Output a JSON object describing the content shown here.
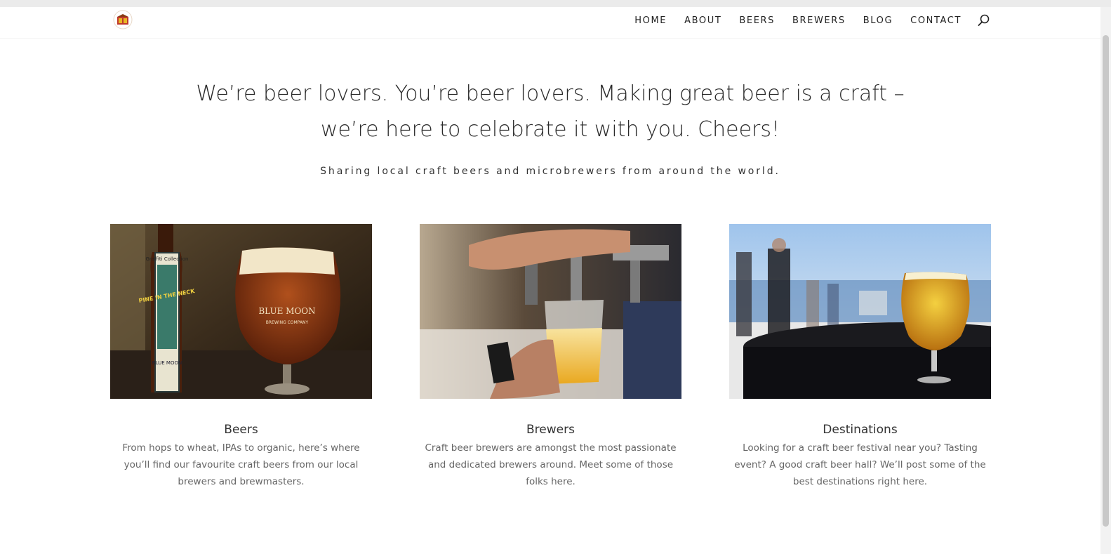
{
  "nav": {
    "items": [
      "HOME",
      "ABOUT",
      "BEERS",
      "BREWERS",
      "BLOG",
      "CONTACT"
    ],
    "search_icon": "search-icon"
  },
  "hero": {
    "line1": "We’re beer lovers. You’re beer lovers. Making great beer is a craft –",
    "line2": "we’re here to celebrate it with you. Cheers!",
    "tagline": "Sharing local craft beers and microbrewers from around the world."
  },
  "cards": [
    {
      "title": "Beers",
      "text": "From hops to wheat, IPAs to organic, here’s where you’ll find our favourite craft beers from our local brewers and brewmasters.",
      "label_top": "Graffiti Collection",
      "label_main": "PINE IN THE NECK",
      "label_brand": "BLUE MOON",
      "glass_brand": "BLUE MOON",
      "glass_sub": "BREWING COMPANY"
    },
    {
      "title": "Brewers",
      "text": "Craft beer brewers are amongst the most passionate and dedicated brewers around. Meet some of those folks here."
    },
    {
      "title": "Destinations",
      "text": "Looking for a craft beer festival near you? Tasting event? A good craft beer hall? We’ll post some of the best destinations right here."
    }
  ],
  "colors": {
    "text_dark": "#222222",
    "text_body": "#666666",
    "beer_amber": "#8a3a12",
    "beer_gold": "#e9b824",
    "logo_red": "#c0392b"
  }
}
